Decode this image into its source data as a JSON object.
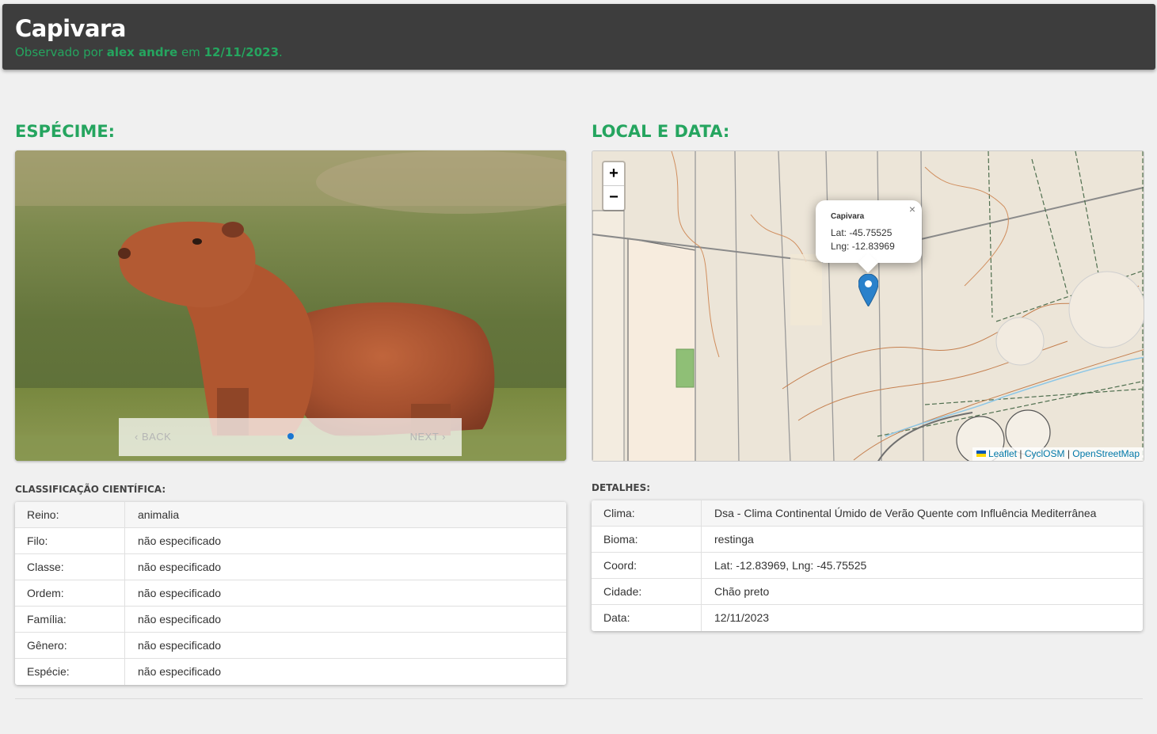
{
  "header": {
    "title": "Capivara",
    "observed_prefix": "Observado por ",
    "observer": "alex andre",
    "date_prefix": " em ",
    "date": "12/11/2023",
    "suffix": "."
  },
  "specimen": {
    "title": "ESPÉCIME:",
    "carousel": {
      "back_label": "BACK",
      "next_label": "NEXT",
      "active_step": 1,
      "total_steps": 1
    }
  },
  "location": {
    "title": "LOCAL E DATA:",
    "map": {
      "zoom_in": "+",
      "zoom_out": "−",
      "popup": {
        "title": "Capivara",
        "lat": "Lat: -45.75525",
        "lng": "Lng: -12.83969",
        "close": "×"
      },
      "attribution": {
        "leaflet": "Leaflet",
        "sep1": " | ",
        "cyclosm": "CyclOSM",
        "sep2": " | ",
        "osm": "OpenStreetMap"
      }
    }
  },
  "classification": {
    "title": "CLASSIFICAÇÃO CIENTÍFICA:",
    "rows": [
      {
        "label": "Reino:",
        "value": "animalia"
      },
      {
        "label": "Filo:",
        "value": "não especificado"
      },
      {
        "label": "Classe:",
        "value": "não especificado"
      },
      {
        "label": "Ordem:",
        "value": "não especificado"
      },
      {
        "label": "Família:",
        "value": "não especificado"
      },
      {
        "label": "Gênero:",
        "value": "não especificado"
      },
      {
        "label": "Espécie:",
        "value": "não especificado"
      }
    ]
  },
  "details": {
    "title": "DETALHES:",
    "rows": [
      {
        "label": "Clima:",
        "value": "Dsa - Clima Continental Úmido de Verão Quente com Influência Mediterrânea"
      },
      {
        "label": "Bioma:",
        "value": "restinga"
      },
      {
        "label": "Coord:",
        "value": "Lat: -12.83969, Lng: -45.75525"
      },
      {
        "label": "Cidade:",
        "value": "Chão preto"
      },
      {
        "label": "Data:",
        "value": "12/11/2023"
      }
    ]
  },
  "colors": {
    "accent": "#25a55f",
    "header_bg": "#3d3d3d",
    "marker": "#2a81cb"
  }
}
